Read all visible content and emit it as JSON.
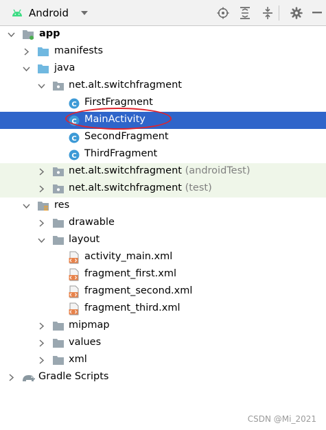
{
  "toolbar": {
    "title": "Android",
    "icons": [
      "android-icon",
      "chevron-down-icon",
      "locate-icon",
      "expand-all-icon",
      "collapse-all-icon",
      "gear-icon",
      "minimize-icon"
    ]
  },
  "tree": {
    "app": "app",
    "manifests": "manifests",
    "java": "java",
    "pkg_main": "net.alt.switchfragment",
    "classes": [
      "FirstFragment",
      "MainActivity",
      "SecondFragment",
      "ThirdFragment"
    ],
    "pkg_android_test": "net.alt.switchfragment",
    "pkg_android_test_suffix": "(androidTest)",
    "pkg_test": "net.alt.switchfragment",
    "pkg_test_suffix": "(test)",
    "res": "res",
    "drawable": "drawable",
    "layout": "layout",
    "layout_files": [
      "activity_main.xml",
      "fragment_first.xml",
      "fragment_second.xml",
      "fragment_third.xml"
    ],
    "mipmap": "mipmap",
    "values": "values",
    "xml": "xml",
    "gradle_scripts": "Gradle Scripts"
  },
  "selected_item": "MainActivity",
  "colors": {
    "selection": "#2f65ca",
    "test_bg": "#eff6e9",
    "annotation": "#e0242c",
    "class_icon": "#3d9ad6"
  },
  "watermark": "CSDN @Mi_2021"
}
